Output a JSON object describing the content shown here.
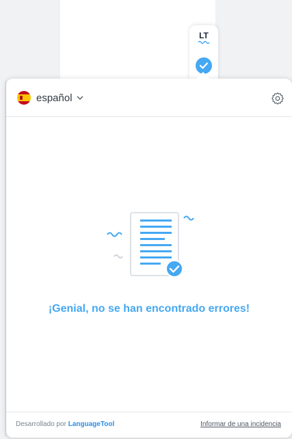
{
  "extension": {
    "logo_text": "LT",
    "logo_icon": "lt-logo-icon",
    "status_icon": "check-icon",
    "accent_color": "#45a8f2"
  },
  "popup": {
    "language": {
      "label": "español",
      "flag_icon": "spain-flag-icon",
      "dropdown_icon": "chevron-down-icon"
    },
    "settings_icon": "gear-icon",
    "illustration_icon": "document-checked-icon",
    "message": "¡Genial, no se han encontrado errores!",
    "footer": {
      "credit_prefix": "Desarrollado por",
      "credit_link": "LanguageTool",
      "report_link": "Informar de una incidencia"
    }
  }
}
